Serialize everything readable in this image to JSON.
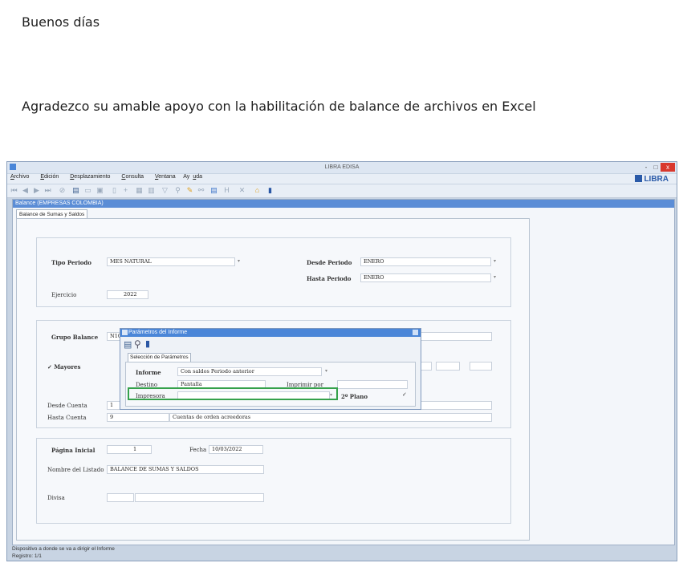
{
  "email": {
    "greeting": "Buenos días",
    "body": "Agradezco su amable apoyo con la habilitación de  balance  de archivos en Excel"
  },
  "window": {
    "title": "LIBRA EDISA",
    "controls": [
      "-",
      "□",
      "x"
    ],
    "menu": [
      {
        "prefix": "",
        "u": "A",
        "rest": "rchivo"
      },
      {
        "prefix": "",
        "u": "E",
        "rest": "dición"
      },
      {
        "prefix": "",
        "u": "D",
        "rest": "esplazamiento"
      },
      {
        "prefix": "",
        "u": "C",
        "rest": "onsulta"
      },
      {
        "prefix": "",
        "u": "V",
        "rest": "entana"
      },
      {
        "prefix": "Ay",
        "u": "u",
        "rest": "da"
      }
    ],
    "logo": "LIBRA"
  },
  "form": {
    "title": "Balance (EMPRESAS COLOMBIA)",
    "tab": "Balance de Sumas y Saldos",
    "tipo_periodo_label": "Tipo Periodo",
    "tipo_periodo_value": "MES NATURAL",
    "desde_periodo_label": "Desde Periodo",
    "desde_periodo_value": "ENERO",
    "hasta_periodo_label": "Hasta Periodo",
    "hasta_periodo_value": "ENERO",
    "ejercicio_label": "Ejercicio",
    "ejercicio_value": "2022",
    "grupo_balance_label": "Grupo Balance",
    "grupo_balance_value": "N10",
    "mayores_label": "Mayores",
    "desde_cuenta_label": "Desde Cuenta",
    "desde_cuenta_value": "1",
    "hasta_cuenta_label": "Hasta Cuenta",
    "hasta_cuenta_value": "9",
    "hasta_cuenta_desc": "Cuentas de orden acreedoras",
    "pagina_inicial_label": "Página Inicial",
    "pagina_inicial_value": "1",
    "fecha_label": "Fecha",
    "fecha_value": "10/03/2022",
    "nombre_listado_label": "Nombre del Listado",
    "nombre_listado_value": "BALANCE DE SUMAS Y SALDOS",
    "divisa_label": "Divisa"
  },
  "dialog": {
    "title": "Parámetros del Informe",
    "tab": "Selección de Parámetros",
    "informe_label": "Informe",
    "informe_value": "Con saldos Periodo anterior",
    "destino_label": "Destino",
    "destino_value": "Pantalla",
    "imprimir_por_label": "Imprimir por",
    "impresora_label": "Impresora",
    "segundo_plano_label": "2º Plano"
  },
  "status": {
    "hint": "Dispositivo a donde se va a dirigir el Informe",
    "record": "Registro: 1/1"
  }
}
